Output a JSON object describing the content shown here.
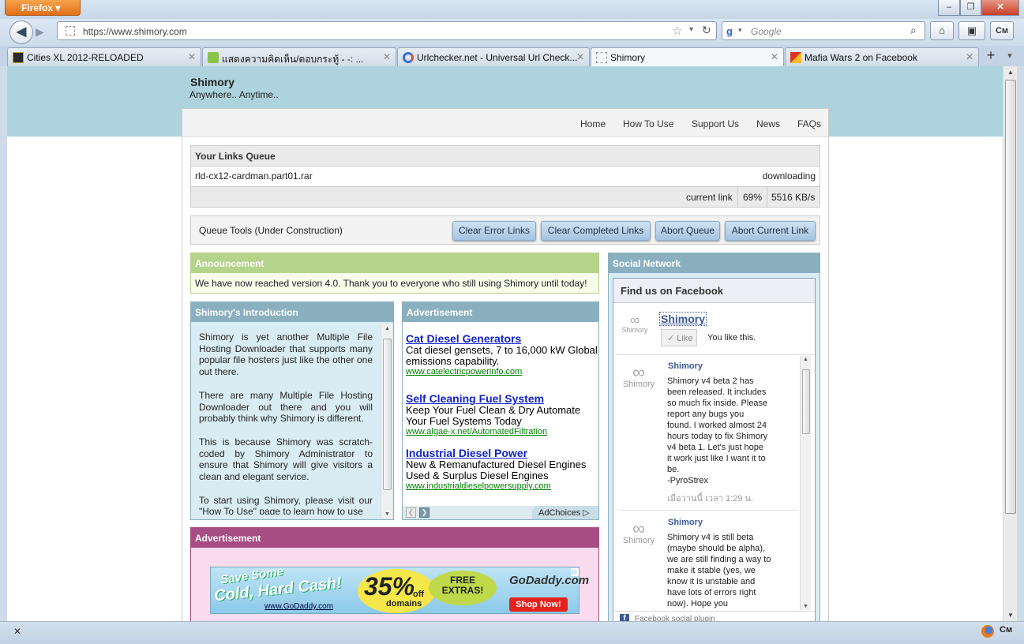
{
  "browser": {
    "app_button": "Firefox",
    "url": "https://www.shimory.com",
    "search_placeholder": "Google",
    "window_controls": [
      "–",
      "❐",
      "✕"
    ],
    "tabs": [
      {
        "label": "Cities XL 2012-RELOADED",
        "icon": "site-favicon"
      },
      {
        "label": "แสดงความคิดเห็น/ตอบกระทู้ - -: ...",
        "icon": "site-favicon"
      },
      {
        "label": "Urlchecker.net - Universal Url Check...",
        "icon": "site-favicon"
      },
      {
        "label": "Shimory",
        "icon": "blank-page-icon"
      },
      {
        "label": "Mafia Wars 2 on Facebook",
        "icon": "site-favicon"
      }
    ],
    "new_tab": "+",
    "close_x": "✕"
  },
  "site": {
    "title": "Shimory",
    "tagline": "Anywhere.. Anytime..",
    "menu": [
      "Home",
      "How To Use",
      "Support Us",
      "News",
      "FAQs"
    ]
  },
  "queue": {
    "heading": "Your Links Queue",
    "file": "rld-cx12-cardman.part01.rar",
    "status": "downloading",
    "current_label": "current link",
    "percent": "69%",
    "progress": 0.69,
    "speed": "5516 KB/s"
  },
  "tools": {
    "label": "Queue Tools (Under Construction)",
    "buttons": [
      "Clear Error Links",
      "Clear Completed Links",
      "Abort Queue",
      "Abort Current Link"
    ]
  },
  "announcement": {
    "heading": "Announcement",
    "text": "We have now reached version 4.0. Thank you to everyone who still using Shimory until today!"
  },
  "intro": {
    "heading": "Shimory's Introduction",
    "paragraphs": [
      "Shimory is yet another Multiple File Hosting Downloader that supports many popular file hosters just like the other one out there.",
      "There are many Multiple File Hosting Downloader out there and you will probably think why Shimory is different.",
      "This is because Shimory was scratch-coded by Shimory Administrator to ensure that Shimory will give visitors a clean and elegant service.",
      "To start using Shimory, please visit our \"How To Use\" page to learn how to use"
    ]
  },
  "ads": {
    "heading": "Advertisement",
    "items": [
      {
        "title": "Cat Diesel Generators",
        "desc": "Cat diesel gensets, 7 to 16,000 kW Global emissions capability.",
        "url": "www.catelectricpowerinfo.com"
      },
      {
        "title": "Self Cleaning Fuel System",
        "desc": "Keep Your Fuel Clean & Dry Automate Your Fuel Systems Today",
        "url": "www.algae-x.net/AutomatedFiltration"
      },
      {
        "title": "Industrial Diesel Power",
        "desc": "New & Remanufactured Diesel Engines Used & Surplus Diesel Engines",
        "url": "www.industrialdieselpowersupply.com"
      }
    ],
    "adchoices": "AdChoices"
  },
  "banner": {
    "heading": "Advertisement",
    "line1": "Save Some",
    "line2": "Cold, Hard Cash!",
    "site": "www.GoDaddy.com",
    "pct": "35%",
    "pct_suffix": "off",
    "pct_sub": "domains",
    "free": "FREE EXTRAS!",
    "brand": "GoDaddy.com",
    "shop": "Shop Now!"
  },
  "social": {
    "heading": "Social Network",
    "fb_heading": "Find us on Facebook",
    "page_name": "Shimory",
    "like_label": "Like",
    "like_status": "You like this.",
    "logo_text": "Shimory",
    "posts": [
      {
        "name": "Shimory",
        "text": "Shimory v4 beta 2 has been released. It includes so much fix inside. Please report any bugs you found. I worked almost 24 hours today to fix Shimory v4 beta 1. Let's just hope it work just like I want it to be.",
        "sign": "-PyroStrex",
        "time": "เมื่อวานนี้ เวลา 1:29 น."
      },
      {
        "name": "Shimory",
        "text": "Shimory v4 is still beta (maybe should be alpha), we are still finding a way to make it stable (yes, we know it is unstable and have lots of errors right now). Hope you"
      }
    ],
    "plugin": "Facebook social plugin"
  },
  "status": {
    "close": "✕"
  }
}
